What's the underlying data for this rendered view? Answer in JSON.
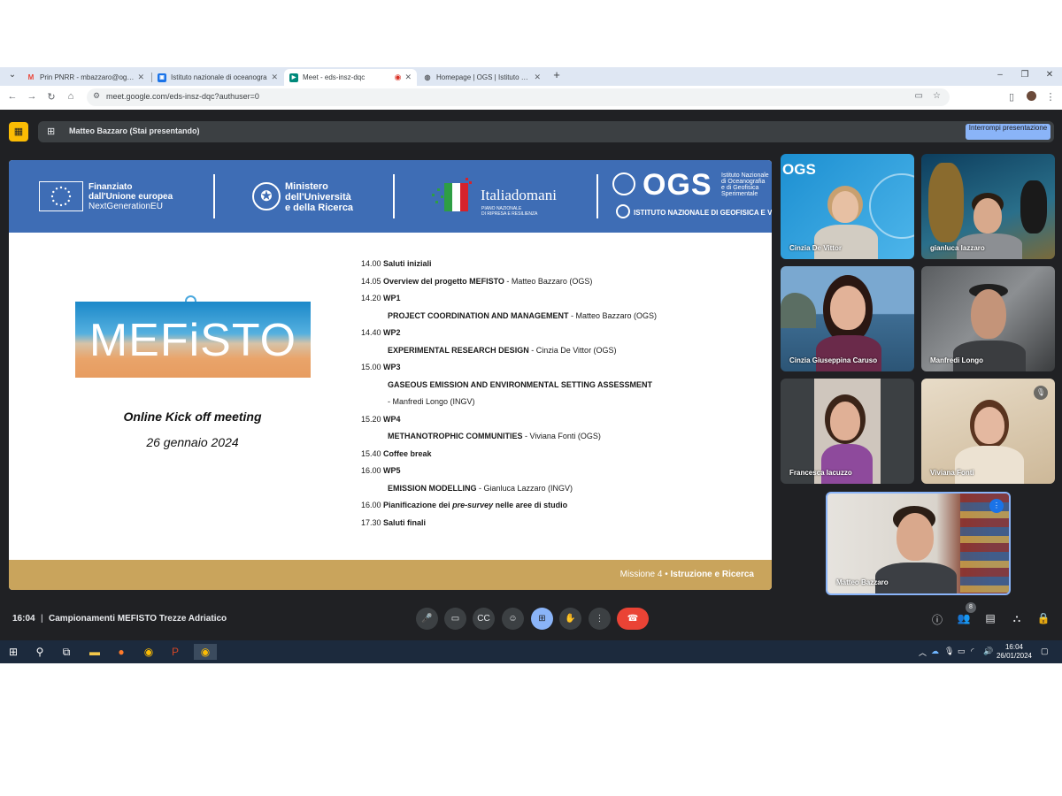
{
  "browser": {
    "tabs": [
      {
        "label": "Prin PNRR - mbazzaro@ogs.it -",
        "icon": "gmail-icon"
      },
      {
        "label": "Istituto nazionale di oceanogra",
        "icon": "site-icon"
      },
      {
        "label": "Meet - eds-insz-dqc",
        "icon": "meet-icon",
        "active": true
      },
      {
        "label": "Homepage | OGS | Istituto Nazi",
        "icon": "globe-icon"
      }
    ],
    "url": "meet.google.com/eds-insz-dqc?authuser=0"
  },
  "topbar": {
    "presenting_label": "Matteo Bazzaro (Stai presentando)",
    "stop_button": "Interrompi presentazione"
  },
  "slide": {
    "header": {
      "eu_line1": "Finanziato",
      "eu_line2": "dall'Unione europea",
      "eu_line3": "NextGenerationEU",
      "mur_line1": "Ministero",
      "mur_line2": "dell'Università",
      "mur_line3": "e della Ricerca",
      "italiadomani": "Italiadomani",
      "italiadomani_sub1": "PIANO NAZIONALE",
      "italiadomani_sub2": "DI RIPRESA E RESILIENZA",
      "ogs": "OGS",
      "ogs_sub1": "Istituto Nazionale",
      "ogs_sub2": "di Oceanografia",
      "ogs_sub3": "e di Geofisica",
      "ogs_sub4": "Sperimentale",
      "ingv": "ISTITUTO NAZIONALE DI GEOFISICA E VULCANOLOGIA"
    },
    "logo_text": "MEFiSTO",
    "meeting_title": "Online Kick off meeting",
    "meeting_date": "26 gennaio 2024",
    "agenda": [
      {
        "time": "14.00",
        "bold": "Saluti iniziali",
        "rest": ""
      },
      {
        "time": "14.05",
        "bold": "Overview del progetto MEFISTO",
        "rest": " - Matteo Bazzaro (OGS)"
      },
      {
        "time": "14.20",
        "bold": "WP1",
        "rest": ""
      },
      {
        "time": "",
        "bold": "PROJECT COORDINATION AND MANAGEMENT",
        "rest": " - Matteo Bazzaro (OGS)"
      },
      {
        "time": "14.40",
        "bold": "WP2",
        "rest": ""
      },
      {
        "time": "",
        "bold": "EXPERIMENTAL RESEARCH DESIGN",
        "rest": " - Cinzia De Vittor (OGS)"
      },
      {
        "time": "15.00",
        "bold": "WP3",
        "rest": ""
      },
      {
        "time": "",
        "bold": "GASEOUS EMISSION AND ENVIRONMENTAL SETTING ASSESSMENT",
        "rest": ""
      },
      {
        "time": "",
        "bold": "",
        "rest": " - Manfredi Longo   (INGV)"
      },
      {
        "time": "15.20",
        "bold": "WP4",
        "rest": ""
      },
      {
        "time": "",
        "bold": "METHANOTROPHIC COMMUNITIES",
        "rest": " - Viviana Fonti (OGS)"
      },
      {
        "time": "15.40",
        "bold": "Coffee break",
        "rest": ""
      },
      {
        "time": "16.00",
        "bold": "WP5",
        "rest": ""
      },
      {
        "time": "",
        "bold": "EMISSION MODELLING",
        "rest": " - Gianluca Lazzaro (INGV)"
      },
      {
        "time": "16.00",
        "bold": "Pianificazione dei ",
        "italic": "pre-survey",
        "bold2": " nelle aree di studio",
        "rest": ""
      },
      {
        "time": "17.30",
        "bold": "Saluti finali",
        "rest": ""
      }
    ],
    "footer_normal": "Missione 4 • ",
    "footer_bold": "Istruzione e Ricerca"
  },
  "participants": [
    {
      "name": "Cinzia De Vittor"
    },
    {
      "name": "gianluca lazzaro"
    },
    {
      "name": "Cinzia Giuseppina Caruso"
    },
    {
      "name": "Manfredi Longo"
    },
    {
      "name": "Francesca Iacuzzo"
    },
    {
      "name": "Viviana Fonti",
      "muted": true
    },
    {
      "name": "Matteo Bazzaro",
      "speaking": true
    }
  ],
  "ogs_tile_text": "OGS",
  "bottombar": {
    "time": "16:04",
    "separator": "|",
    "meeting_name": "Campionamenti MEFISTO Trezze Adriatico",
    "participant_count": "8"
  },
  "taskbar": {
    "time": "16:04",
    "date": "26/01/2024"
  },
  "colors": {
    "meet_bg": "#202124",
    "slide_header": "#3e6db5",
    "slide_footer": "#c9a45c",
    "end_call": "#ea4335",
    "present_active": "#8ab4f8"
  }
}
